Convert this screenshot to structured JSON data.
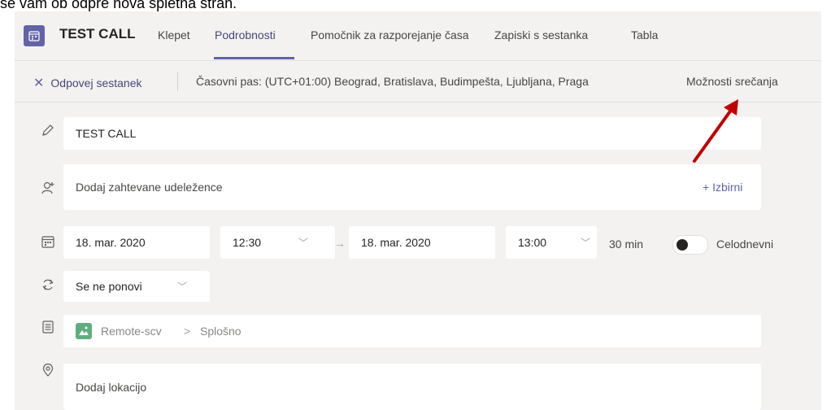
{
  "doc_text": "se vam ob odpre nova spletna stran.",
  "header": {
    "title": "TEST CALL",
    "tabs": [
      {
        "label": "Klepet"
      },
      {
        "label": "Podrobnosti"
      },
      {
        "label": "Pomočnik za razporejanje časa"
      },
      {
        "label": "Zapiski s sestanka"
      },
      {
        "label": "Tabla"
      }
    ],
    "active_tab": "Podrobnosti"
  },
  "commands": {
    "cancel_label": "Odpovej sestanek",
    "timezone": "Časovni pas: (UTC+01:00) Beograd, Bratislava, Budimpešta, Ljubljana, Praga",
    "options_label": "Možnosti srečanja"
  },
  "form": {
    "title_value": "TEST CALL",
    "attendees_placeholder": "Dodaj zahtevane udeležence",
    "optional_label": "+ Izbirni",
    "start_date": "18. mar. 2020",
    "start_time": "12:30",
    "end_date": "18. mar. 2020",
    "end_time": "13:00",
    "duration": "30 min",
    "all_day_label": "Celodnevni",
    "all_day": false,
    "repeat": "Se ne ponovi",
    "channel_team": "Remote-scv",
    "channel_separator": ">",
    "channel_name": "Splošno",
    "location_placeholder": "Dodaj lokacijo"
  },
  "colors": {
    "accent": "#6264a7",
    "annotation_arrow": "#c00000"
  }
}
